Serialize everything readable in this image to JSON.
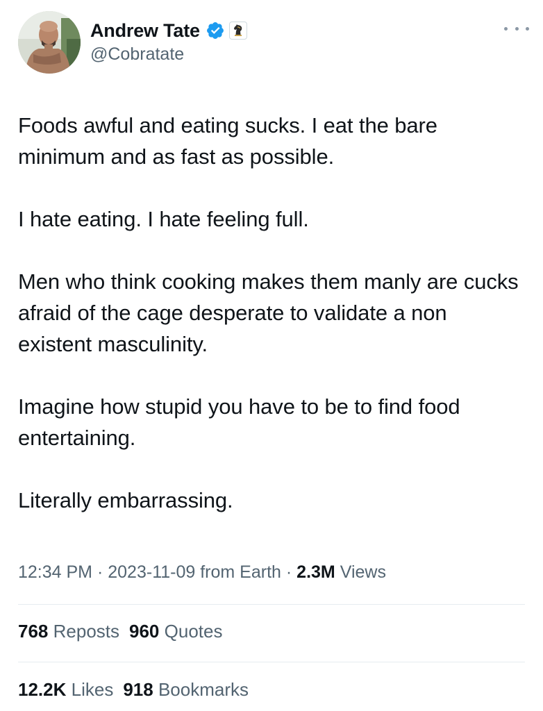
{
  "author": {
    "display_name": "Andrew Tate",
    "handle": "@Cobratate",
    "verified_icon": "verified-badge-icon",
    "affiliate_icon": "chess-knight-icon",
    "accent_color": "#1d9bf0"
  },
  "more_menu_icon": "more-horizontal-icon",
  "tweet": {
    "paragraphs": [
      "Foods awful and eating sucks. I eat the bare minimum and as fast as possible.",
      "I hate eating. I hate feeling full.",
      "Men who think cooking makes them manly are cucks afraid of the cage desperate to validate a non existent masculinity.",
      "Imagine how stupid you have to be to find food entertaining.",
      "Literally embarrassing."
    ]
  },
  "meta": {
    "time": "12:34 PM",
    "separator": "·",
    "date": "2023-11-09",
    "location": "from Earth",
    "views_count": "2.3M",
    "views_label": "Views"
  },
  "stats": {
    "reposts_count": "768",
    "reposts_label": "Reposts",
    "quotes_count": "960",
    "quotes_label": "Quotes",
    "likes_count": "12.2K",
    "likes_label": "Likes",
    "bookmarks_count": "918",
    "bookmarks_label": "Bookmarks"
  },
  "colors": {
    "text_primary": "#0f1419",
    "text_secondary": "#536471",
    "divider": "#e6ecf0"
  }
}
